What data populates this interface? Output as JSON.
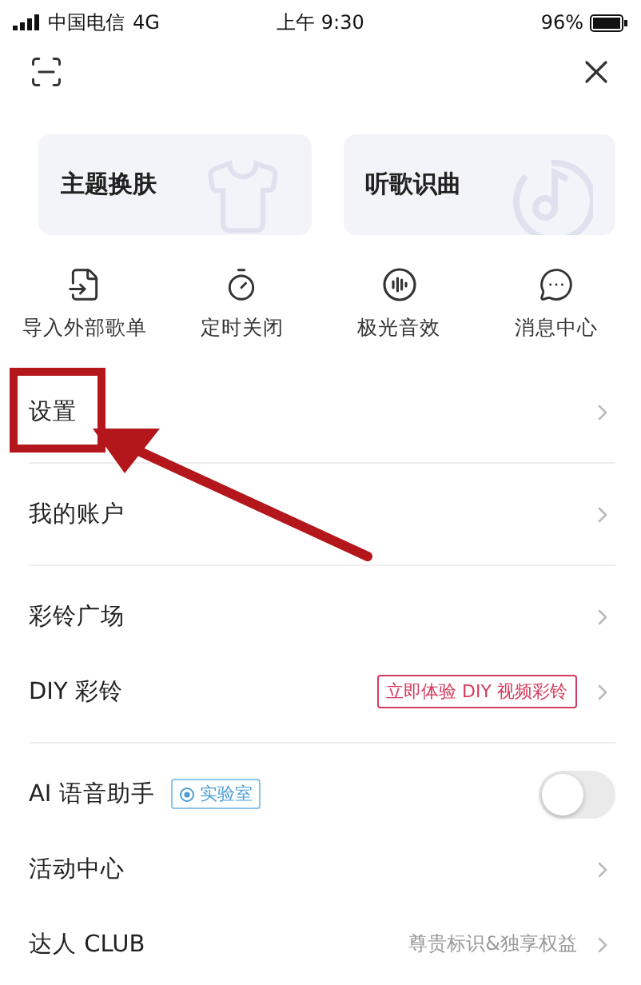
{
  "status_bar": {
    "carrier": "中国电信",
    "network": "4G",
    "time": "上午 9:30",
    "battery": "96%"
  },
  "cards": [
    {
      "label": "主题换肤",
      "kind": "theme"
    },
    {
      "label": "听歌识曲",
      "kind": "music"
    }
  ],
  "quick_actions": [
    {
      "label": "导入外部歌单",
      "kind": "import"
    },
    {
      "label": "定时关闭",
      "kind": "timer"
    },
    {
      "label": "极光音效",
      "kind": "sound"
    },
    {
      "label": "消息中心",
      "kind": "message"
    }
  ],
  "menu_sections": [
    [
      {
        "label": "设置",
        "kind": "link",
        "highlighted": true
      }
    ],
    [
      {
        "label": "我的账户",
        "kind": "link",
        "highlighted": false
      }
    ],
    [
      {
        "label": "彩铃广场",
        "kind": "link",
        "highlighted": false
      },
      {
        "label": "DIY 彩铃",
        "kind": "link",
        "highlighted": false,
        "tag": "立即体验 DIY 视频彩铃"
      }
    ],
    [
      {
        "label": "AI 语音助手",
        "kind": "toggle",
        "badge": "实验室",
        "on": false
      },
      {
        "label": "活动中心",
        "kind": "link",
        "highlighted": false
      },
      {
        "label": "达人 CLUB",
        "kind": "link",
        "highlighted": false,
        "hint": "尊贵标识&独享权益"
      }
    ]
  ]
}
